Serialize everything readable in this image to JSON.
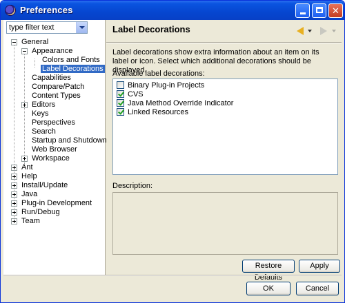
{
  "window": {
    "title": "Preferences"
  },
  "left": {
    "filter_text": "type filter text",
    "tree": [
      {
        "label": "General",
        "expander": "minus"
      },
      {
        "label": "Appearance",
        "expander": "minus"
      },
      {
        "label": "Colors and Fonts"
      },
      {
        "label": "Label Decorations",
        "selected": true
      },
      {
        "label": "Capabilities"
      },
      {
        "label": "Compare/Patch"
      },
      {
        "label": "Content Types"
      },
      {
        "label": "Editors",
        "expander": "plus"
      },
      {
        "label": "Keys"
      },
      {
        "label": "Perspectives"
      },
      {
        "label": "Search"
      },
      {
        "label": "Startup and Shutdown"
      },
      {
        "label": "Web Browser"
      },
      {
        "label": "Workspace",
        "expander": "plus"
      },
      {
        "label": "Ant",
        "expander": "plus"
      },
      {
        "label": "Help",
        "expander": "plus"
      },
      {
        "label": "Install/Update",
        "expander": "plus"
      },
      {
        "label": "Java",
        "expander": "plus"
      },
      {
        "label": "Plug-in Development",
        "expander": "plus"
      },
      {
        "label": "Run/Debug",
        "expander": "plus"
      },
      {
        "label": "Team",
        "expander": "plus"
      }
    ]
  },
  "page": {
    "title": "Label Decorations",
    "description": "Label decorations show extra information about an item on its label or icon. Select which additional decorations should be displayed.",
    "available_label": "Available label decorations:",
    "decorations": [
      {
        "label": "Binary Plug-in Projects",
        "checked": false
      },
      {
        "label": "CVS",
        "checked": true
      },
      {
        "label": "Java Method Override Indicator",
        "checked": true
      },
      {
        "label": "Linked Resources",
        "checked": true
      }
    ],
    "description_label": "Description:",
    "restore_defaults": "Restore Defaults",
    "apply": "Apply"
  },
  "footer": {
    "ok": "OK",
    "cancel": "Cancel"
  },
  "icons": [
    "eclipse-icon",
    "minimize-icon",
    "maximize-icon",
    "close-icon",
    "dropdown-arrow-icon",
    "back-arrow-icon",
    "forward-arrow-icon"
  ],
  "colors": {
    "titlebar": "#0646d0",
    "selection": "#316ac5",
    "dialog_bg": "#ece9d8"
  }
}
